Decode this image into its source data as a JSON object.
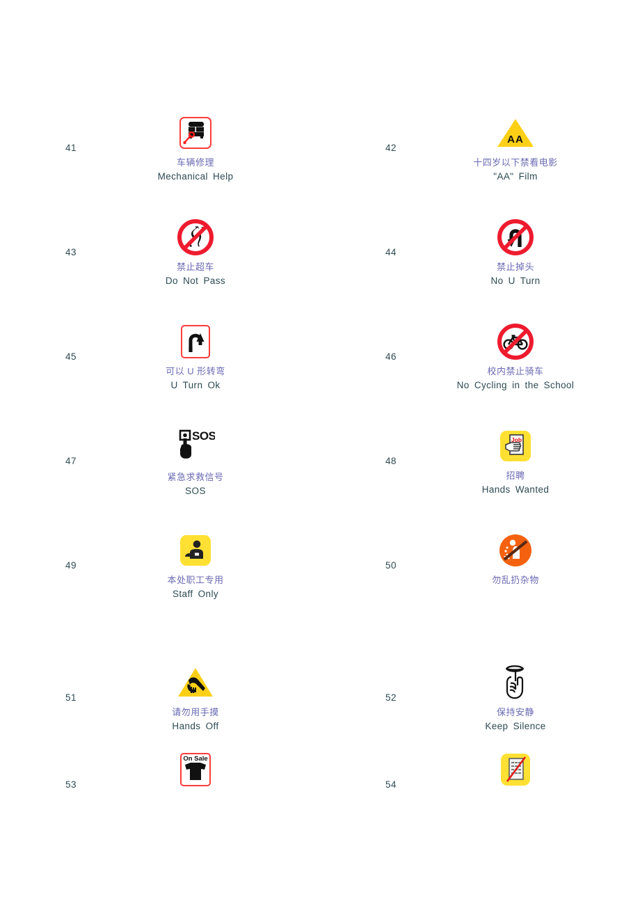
{
  "page": {
    "title_visible": false,
    "background": "#ffffff",
    "caption_cn_color": "#6a6ab4",
    "caption_en_color": "#2c4a52",
    "number_color": "#2c4a52",
    "accent_red": "#ff3b3b",
    "accent_yellow": "#ffe033",
    "accent_orange": "#f4620f"
  },
  "signs": [
    {
      "number": "41",
      "icon": "bus-wrench-mechanical-help-icon",
      "caption_cn": "车辆修理",
      "caption_en": "Mechanical Help"
    },
    {
      "number": "42",
      "icon": "yellow-triangle-aa-film-icon",
      "icon_text": "AA",
      "caption_cn": "十四岁以下禁看电影",
      "caption_en": "\"AA\"  Film"
    },
    {
      "number": "43",
      "icon": "no-overtaking-icon",
      "caption_cn": "禁止超车",
      "caption_en": "Do  Not  Pass"
    },
    {
      "number": "44",
      "icon": "no-u-turn-icon",
      "caption_cn": "禁止掉头",
      "caption_en": "No  U  Turn"
    },
    {
      "number": "45",
      "icon": "u-turn-ok-icon",
      "caption_cn": "可以 U 形转弯",
      "caption_en": "U  Turn  Ok"
    },
    {
      "number": "46",
      "icon": "no-cycling-icon",
      "caption_cn": "校内禁止骑车",
      "caption_en": "No  Cycling  in  the  School"
    },
    {
      "number": "47",
      "icon": "sos-button-hand-icon",
      "icon_text": "SOS",
      "caption_cn": "紧急求救信号",
      "caption_en": "SOS"
    },
    {
      "number": "48",
      "icon": "job-hands-wanted-icon",
      "icon_text": "Job",
      "caption_cn": "招聘",
      "caption_en": "Hands  Wanted"
    },
    {
      "number": "49",
      "icon": "staff-only-badge-person-icon",
      "caption_cn": "本处职工专用",
      "caption_en": "Staff  Only"
    },
    {
      "number": "50",
      "icon": "no-littering-icon",
      "caption_cn": "勿乱扔杂物",
      "caption_en": ""
    },
    {
      "number": "51",
      "icon": "esd-hands-off-triangle-icon",
      "caption_cn": "请勿用手摸",
      "caption_en": "Hands  Off"
    },
    {
      "number": "52",
      "icon": "finger-on-lips-keep-silence-icon",
      "caption_cn": "保持安静",
      "caption_en": "Keep  Silence"
    },
    {
      "number": "53",
      "icon": "on-sale-tshirt-icon",
      "icon_text": "On Sale",
      "caption_cn": "",
      "caption_en": ""
    },
    {
      "number": "54",
      "icon": "no-documents-crossed-out-icon",
      "caption_cn": "",
      "caption_en": ""
    }
  ]
}
